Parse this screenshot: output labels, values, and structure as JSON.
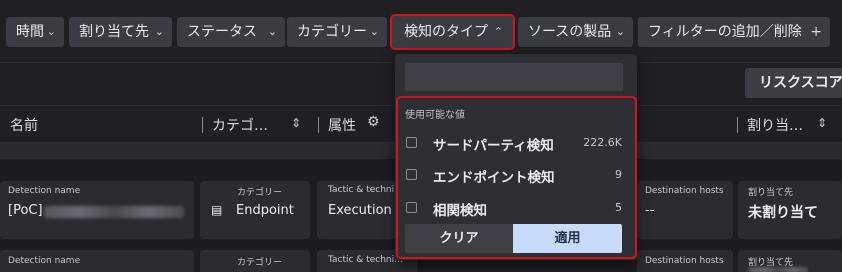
{
  "filters": [
    {
      "label": "時間",
      "caret": "⌄"
    },
    {
      "label": "割り当て先",
      "caret": "⌄"
    },
    {
      "label": "ステータス",
      "caret": "⌄"
    },
    {
      "label": "カテゴリー",
      "caret": "⌄"
    },
    {
      "label": "検知のタイプ",
      "caret": "⌃"
    },
    {
      "label": "ソースの製品",
      "caret": "⌄"
    },
    {
      "label": "フィルターの追加／削除",
      "caret": "+"
    }
  ],
  "toolbar": {
    "risk_score_button": "リスクスコア"
  },
  "columns": {
    "name": "名前",
    "category": "カテゴ…",
    "attribute": "属性",
    "assignee": "割り当…"
  },
  "rows": [
    {
      "detection_name_label": "Detection name",
      "detection_name_value": "[PoC]",
      "category_label": "カテゴリー",
      "category_value": "Endpoint",
      "tactic_label": "Tactic & techni…",
      "tactic_value": "Execution v",
      "dest_label": "Destination hosts",
      "dest_value": "--",
      "assignee_label": "割り当て先",
      "assignee_value": "未割り当て"
    },
    {
      "detection_name_label": "Detection name",
      "category_label": "カテゴリー",
      "tactic_label": "Tactic & techni…",
      "dest_label": "Destination hosts",
      "assignee_label": "割り当て先"
    }
  ],
  "dropdown": {
    "section_title": "使用可能な値",
    "options": [
      {
        "label": "サードパーティ検知",
        "count": "222.6K",
        "checked": false
      },
      {
        "label": "エンドポイント検知",
        "count": "9",
        "checked": false
      },
      {
        "label": "相関検知",
        "count": "5",
        "checked": false
      }
    ],
    "clear_label": "クリア",
    "apply_label": "適用"
  }
}
